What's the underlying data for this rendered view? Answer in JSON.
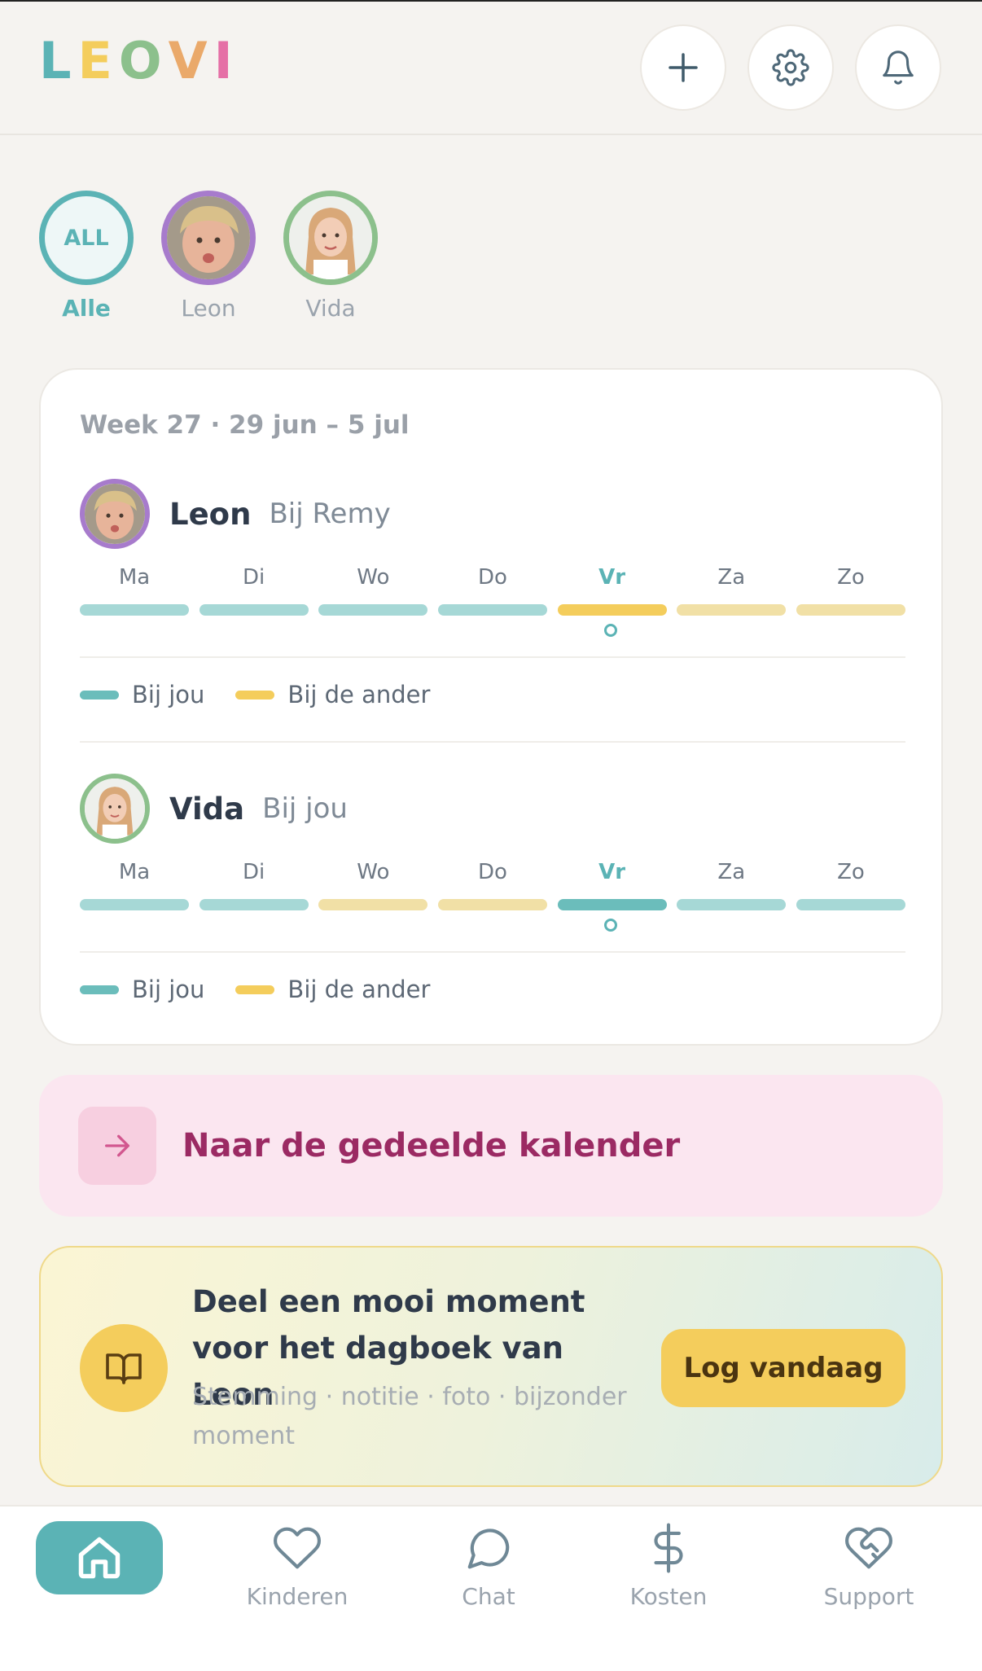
{
  "app": {
    "logo_letters": [
      "L",
      "E",
      "O",
      "V",
      "I"
    ],
    "logo_colors": [
      "#5bb3b5",
      "#f4cd5c",
      "#8cc08c",
      "#eaa96a",
      "#e56fa6"
    ]
  },
  "header": {
    "buttons": [
      "plus-icon",
      "gear-icon",
      "bell-icon"
    ]
  },
  "children_filter": [
    {
      "label": "Alle",
      "badge": "ALL",
      "ring_color": "#5bb3b5",
      "active": true
    },
    {
      "label": "Leon",
      "ring_color": "#a77bcc",
      "active": false
    },
    {
      "label": "Vida",
      "ring_color": "#8cc08c",
      "active": false
    }
  ],
  "week_card": {
    "week_label": "Week 27 · 29 jun – 5 jul",
    "children": [
      {
        "name": "Leon",
        "location": "Bij Remy",
        "days": [
          "Ma",
          "Di",
          "Wo",
          "Do",
          "Vr",
          "Za",
          "Zo"
        ],
        "today_index": 4,
        "custody": [
          "jou",
          "jou",
          "jou",
          "jou",
          "ander",
          "ander",
          "ander"
        ]
      },
      {
        "name": "Vida",
        "location": "Bij jou",
        "days": [
          "Ma",
          "Di",
          "Wo",
          "Do",
          "Vr",
          "Za",
          "Zo"
        ],
        "today_index": 4,
        "custody": [
          "jou",
          "jou",
          "ander",
          "ander",
          "jou",
          "jou",
          "jou"
        ]
      }
    ],
    "legend": {
      "mine": "Bij jou",
      "other": "Bij de ander"
    },
    "colors": {
      "mine": "#a6d8d6",
      "mine_today": "#6bbdbb",
      "other": "#f1e0a6",
      "other_today": "#f4cd5c"
    }
  },
  "calendar_link": {
    "label": "Naar de gedeelde kalender"
  },
  "diary": {
    "title": "Deel een mooi moment voor het dagboek van Leon",
    "subtitle": "Stemming · notitie · foto · bijzonder moment",
    "button": "Log vandaag"
  },
  "bottom_nav": {
    "items": [
      "Kinderen",
      "Chat",
      "Kosten",
      "Support"
    ]
  }
}
